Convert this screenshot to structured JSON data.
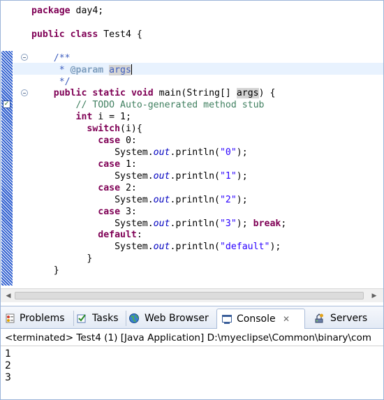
{
  "editor": {
    "lines": [
      [
        {
          "t": "package",
          "c": "kw"
        },
        {
          "t": " day4;",
          "c": ""
        }
      ],
      [],
      [
        {
          "t": "public",
          "c": "kw"
        },
        {
          "t": " ",
          "c": ""
        },
        {
          "t": "class",
          "c": "kw"
        },
        {
          "t": " Test4 {",
          "c": ""
        }
      ],
      [],
      [
        {
          "t": "    /**",
          "c": "jd"
        }
      ],
      [
        {
          "t": "     * ",
          "c": "jd"
        },
        {
          "t": "@param",
          "c": "tag"
        },
        {
          "t": " ",
          "c": "jd"
        },
        {
          "t": "args",
          "c": "jd occ"
        },
        {
          "t": "",
          "c": "caret"
        }
      ],
      [
        {
          "t": "     */",
          "c": "jd"
        }
      ],
      [
        {
          "t": "    ",
          "c": ""
        },
        {
          "t": "public",
          "c": "kw"
        },
        {
          "t": " ",
          "c": ""
        },
        {
          "t": "static",
          "c": "kw"
        },
        {
          "t": " ",
          "c": ""
        },
        {
          "t": "void",
          "c": "kw"
        },
        {
          "t": " main(String[] ",
          "c": ""
        },
        {
          "t": "args",
          "c": "occ"
        },
        {
          "t": ") {",
          "c": ""
        }
      ],
      [
        {
          "t": "        ",
          "c": ""
        },
        {
          "t": "// TODO Auto-generated method stub",
          "c": "cm"
        }
      ],
      [
        {
          "t": "        ",
          "c": ""
        },
        {
          "t": "int",
          "c": "kw"
        },
        {
          "t": " i = 1;",
          "c": ""
        }
      ],
      [
        {
          "t": "          ",
          "c": ""
        },
        {
          "t": "switch",
          "c": "kw"
        },
        {
          "t": "(i){",
          "c": ""
        }
      ],
      [
        {
          "t": "            ",
          "c": ""
        },
        {
          "t": "case",
          "c": "kw"
        },
        {
          "t": " 0:",
          "c": ""
        }
      ],
      [
        {
          "t": "               System.",
          "c": ""
        },
        {
          "t": "out",
          "c": "st"
        },
        {
          "t": ".println(",
          "c": ""
        },
        {
          "t": "\"0\"",
          "c": "str"
        },
        {
          "t": ");",
          "c": ""
        }
      ],
      [
        {
          "t": "            ",
          "c": ""
        },
        {
          "t": "case",
          "c": "kw"
        },
        {
          "t": " 1:",
          "c": ""
        }
      ],
      [
        {
          "t": "               System.",
          "c": ""
        },
        {
          "t": "out",
          "c": "st"
        },
        {
          "t": ".println(",
          "c": ""
        },
        {
          "t": "\"1\"",
          "c": "str"
        },
        {
          "t": ");",
          "c": ""
        }
      ],
      [
        {
          "t": "            ",
          "c": ""
        },
        {
          "t": "case",
          "c": "kw"
        },
        {
          "t": " 2:",
          "c": ""
        }
      ],
      [
        {
          "t": "               System.",
          "c": ""
        },
        {
          "t": "out",
          "c": "st"
        },
        {
          "t": ".println(",
          "c": ""
        },
        {
          "t": "\"2\"",
          "c": "str"
        },
        {
          "t": ");",
          "c": ""
        }
      ],
      [
        {
          "t": "            ",
          "c": ""
        },
        {
          "t": "case",
          "c": "kw"
        },
        {
          "t": " 3:",
          "c": ""
        }
      ],
      [
        {
          "t": "               System.",
          "c": ""
        },
        {
          "t": "out",
          "c": "st"
        },
        {
          "t": ".println(",
          "c": ""
        },
        {
          "t": "\"3\"",
          "c": "str"
        },
        {
          "t": "); ",
          "c": ""
        },
        {
          "t": "break",
          "c": "kw"
        },
        {
          "t": ";",
          "c": ""
        }
      ],
      [
        {
          "t": "            ",
          "c": ""
        },
        {
          "t": "default",
          "c": "kw"
        },
        {
          "t": ":",
          "c": ""
        }
      ],
      [
        {
          "t": "               System.",
          "c": ""
        },
        {
          "t": "out",
          "c": "st"
        },
        {
          "t": ".println(",
          "c": ""
        },
        {
          "t": "\"default\"",
          "c": "str"
        },
        {
          "t": ");",
          "c": ""
        }
      ],
      [
        {
          "t": "          }",
          "c": ""
        }
      ],
      [
        {
          "t": "    }",
          "c": ""
        }
      ],
      [],
      [
        {
          "t": "}",
          "c": ""
        }
      ]
    ]
  },
  "tabs": [
    {
      "label": "Problems",
      "icon": "problems-icon"
    },
    {
      "label": "Tasks",
      "icon": "tasks-icon"
    },
    {
      "label": "Web Browser",
      "icon": "web-browser-icon"
    },
    {
      "label": "Console",
      "icon": "console-icon",
      "active": true,
      "close": "✕"
    },
    {
      "label": "Servers",
      "icon": "servers-icon"
    }
  ],
  "console": {
    "status": "<terminated> Test4 (1) [Java Application] D:\\myeclipse\\Common\\binary\\com",
    "output": [
      "1",
      "2",
      "3"
    ]
  },
  "colors": {
    "keyword": "#7f0055",
    "comment": "#3f7f5f",
    "javadoc": "#3f5fbf",
    "string": "#2a00ff",
    "static_field": "#0000c0",
    "overview_ruler": "#2f5fd0"
  }
}
